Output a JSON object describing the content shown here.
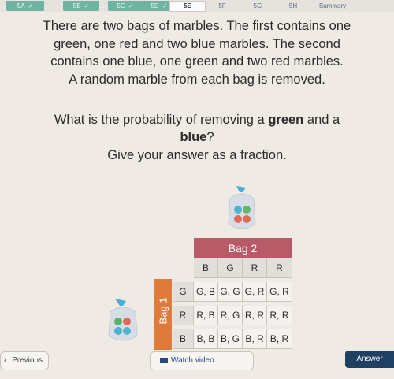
{
  "tabs": [
    {
      "label": "5A",
      "done": true
    },
    {
      "label": "5B",
      "done": true
    },
    {
      "label": "5C",
      "done": true
    },
    {
      "label": "5D",
      "done": true
    },
    {
      "label": "5E",
      "done": false,
      "active": true
    },
    {
      "label": "5F"
    },
    {
      "label": "5G"
    },
    {
      "label": "5H"
    },
    {
      "label": "Summary"
    }
  ],
  "question": {
    "line1": "There are two bags of marbles. The first contains one",
    "line2": "green, one red and two blue marbles. The second",
    "line3": "contains one blue, one green and two red marbles.",
    "line4": "A random marble from each bag is removed.",
    "q_prefix": "What is the probability of removing a ",
    "q_green": "green",
    "q_mid": " and a",
    "q_blue": "blue",
    "q_end": "?",
    "instruction": "Give your answer as a fraction."
  },
  "table": {
    "bag2_title": "Bag 2",
    "bag1_title": "Bag 1",
    "columns": [
      "B",
      "G",
      "R",
      "R"
    ],
    "rows": [
      {
        "label": "G",
        "cells": [
          "G, B",
          "G, G",
          "G, R",
          "G, R"
        ]
      },
      {
        "label": "R",
        "cells": [
          "R, B",
          "R, G",
          "R, R",
          "R, R"
        ]
      },
      {
        "label": "B",
        "cells": [
          "B, B",
          "B, G",
          "B, R",
          "B, R"
        ]
      }
    ]
  },
  "buttons": {
    "previous": "Previous",
    "watch": "Watch video",
    "answer": "Answer"
  },
  "colors": {
    "green": "#5ab16a",
    "red": "#e06a5a",
    "blue": "#5ab2cf",
    "bag2_header": "#b95a68",
    "bag1_header": "#df7a3a"
  }
}
